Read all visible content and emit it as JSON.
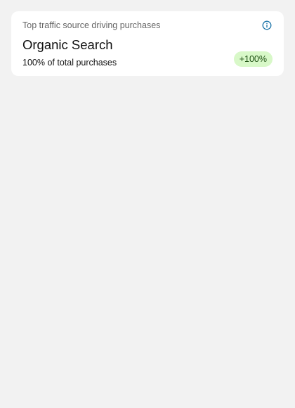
{
  "card": {
    "subtitle": "Top traffic source driving purchases",
    "title": "Organic Search",
    "caption": "100% of total purchases",
    "badge": "+100%"
  },
  "icons": {
    "info": "info-icon"
  },
  "colors": {
    "page_background": "#f2f2f2",
    "card_background": "#ffffff",
    "info_icon": "#1a73a8",
    "badge_background": "#d8f8c8",
    "badge_text": "#1d4f12",
    "subtitle_text": "#666666",
    "body_text": "#111111"
  }
}
